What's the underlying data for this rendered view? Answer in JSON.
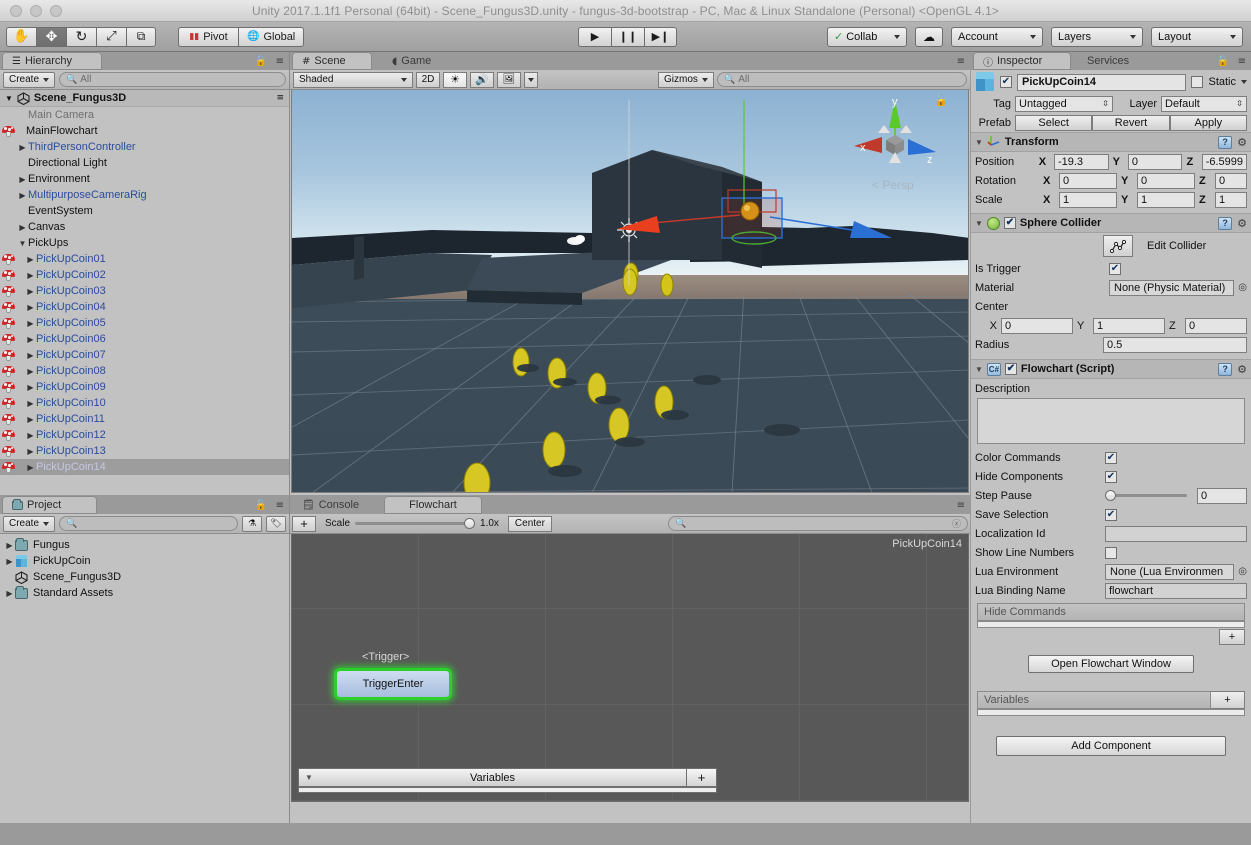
{
  "window": {
    "title": "Unity 2017.1.1f1 Personal (64bit) - Scene_Fungus3D.unity - fungus-3d-bootstrap - PC, Mac & Linux Standalone (Personal) <OpenGL 4.1>"
  },
  "toolbar": {
    "tools": [
      {
        "name": "hand-tool",
        "glyph": "✋",
        "active": false
      },
      {
        "name": "move-tool",
        "glyph": "✥",
        "active": true
      },
      {
        "name": "rotate-tool",
        "glyph": "⟳",
        "active": false
      },
      {
        "name": "scale-tool",
        "glyph": "⤢",
        "active": false
      },
      {
        "name": "rect-tool",
        "glyph": "❑",
        "active": false
      }
    ],
    "pivot_label": "Pivot",
    "global_label": "Global",
    "play_label": "▶",
    "pause_label": "❙❙",
    "step_label": "▶❙",
    "collab_label": "Collab",
    "cloud_label": "☁",
    "account_label": "Account",
    "layers_label": "Layers",
    "layout_label": "Layout"
  },
  "hierarchy": {
    "tab_label": "Hierarchy",
    "create_label": "Create",
    "search_placeholder": "All",
    "scene_name": "Scene_Fungus3D",
    "items": [
      {
        "label": "Main Camera",
        "indent": 1,
        "arrow": false,
        "icon": "none",
        "style": "dim"
      },
      {
        "label": "MainFlowchart",
        "indent": 1,
        "arrow": false,
        "icon": "mushroom",
        "style": "normal"
      },
      {
        "label": "ThirdPersonController",
        "indent": 1,
        "arrow": true,
        "icon": "none",
        "style": "prefab"
      },
      {
        "label": "Directional Light",
        "indent": 1,
        "arrow": false,
        "icon": "none",
        "style": "normal"
      },
      {
        "label": "Environment",
        "indent": 1,
        "arrow": true,
        "icon": "none",
        "style": "normal"
      },
      {
        "label": "MultipurposeCameraRig",
        "indent": 1,
        "arrow": true,
        "icon": "none",
        "style": "prefab"
      },
      {
        "label": "EventSystem",
        "indent": 1,
        "arrow": false,
        "icon": "none",
        "style": "normal"
      },
      {
        "label": "Canvas",
        "indent": 1,
        "arrow": true,
        "icon": "none",
        "style": "normal"
      },
      {
        "label": "PickUps",
        "indent": 1,
        "arrow": "open",
        "icon": "none",
        "style": "normal"
      },
      {
        "label": "PickUpCoin01",
        "indent": 2,
        "arrow": true,
        "icon": "mushroom",
        "style": "prefab"
      },
      {
        "label": "PickUpCoin02",
        "indent": 2,
        "arrow": true,
        "icon": "mushroom",
        "style": "prefab"
      },
      {
        "label": "PickUpCoin03",
        "indent": 2,
        "arrow": true,
        "icon": "mushroom",
        "style": "prefab"
      },
      {
        "label": "PickUpCoin04",
        "indent": 2,
        "arrow": true,
        "icon": "mushroom",
        "style": "prefab"
      },
      {
        "label": "PickUpCoin05",
        "indent": 2,
        "arrow": true,
        "icon": "mushroom",
        "style": "prefab"
      },
      {
        "label": "PickUpCoin06",
        "indent": 2,
        "arrow": true,
        "icon": "mushroom",
        "style": "prefab"
      },
      {
        "label": "PickUpCoin07",
        "indent": 2,
        "arrow": true,
        "icon": "mushroom",
        "style": "prefab"
      },
      {
        "label": "PickUpCoin08",
        "indent": 2,
        "arrow": true,
        "icon": "mushroom",
        "style": "prefab"
      },
      {
        "label": "PickUpCoin09",
        "indent": 2,
        "arrow": true,
        "icon": "mushroom",
        "style": "prefab"
      },
      {
        "label": "PickUpCoin10",
        "indent": 2,
        "arrow": true,
        "icon": "mushroom",
        "style": "prefab"
      },
      {
        "label": "PickUpCoin11",
        "indent": 2,
        "arrow": true,
        "icon": "mushroom",
        "style": "prefab"
      },
      {
        "label": "PickUpCoin12",
        "indent": 2,
        "arrow": true,
        "icon": "mushroom",
        "style": "prefab"
      },
      {
        "label": "PickUpCoin13",
        "indent": 2,
        "arrow": true,
        "icon": "mushroom",
        "style": "prefab"
      },
      {
        "label": "PickUpCoin14",
        "indent": 2,
        "arrow": true,
        "icon": "mushroom",
        "style": "selected",
        "selected": true
      }
    ]
  },
  "project": {
    "tab_label": "Project",
    "create_label": "Create",
    "search_placeholder": "",
    "items": [
      {
        "label": "Fungus",
        "arrow": true,
        "icon": "folder"
      },
      {
        "label": "PickUpCoin",
        "arrow": true,
        "icon": "cube"
      },
      {
        "label": "Scene_Fungus3D",
        "arrow": false,
        "icon": "unity"
      },
      {
        "label": "Standard Assets",
        "arrow": true,
        "icon": "folder"
      }
    ]
  },
  "scene_view": {
    "tabs": [
      {
        "label": "Scene",
        "active": true
      },
      {
        "label": "Game",
        "active": false
      }
    ],
    "shading_mode": "Shaded",
    "mode_2d": "2D",
    "gizmos_label": "Gizmos",
    "search_placeholder": "All",
    "gizmo": {
      "x_label": "x",
      "y_label": "y",
      "z_label": "z",
      "perspective_label": "< Persp",
      "x_color": "#c0392b",
      "y_color": "#5cc92b",
      "z_color": "#2a6fd4"
    },
    "colors": {
      "sky_top": "#8fb4d4",
      "sky_horizon": "#dceaf2",
      "ground_far": "#8d7d74",
      "floor": "#3e4f5c",
      "building": "#2e3a45"
    }
  },
  "flowchart_panel": {
    "tabs": [
      {
        "label": "Console",
        "active": false
      },
      {
        "label": "Flowchart",
        "active": true
      }
    ],
    "add_label": "+",
    "scale_label": "Scale",
    "scale_value": "1.0x",
    "center_label": "Center",
    "search_placeholder": "",
    "flowchart_name": "PickUpCoin14",
    "block_event_label": "<Trigger>",
    "block_label": "TriggerEnter",
    "variables_label": "Variables",
    "variables_add_label": "+"
  },
  "inspector": {
    "tabs": [
      {
        "label": "Inspector",
        "active": true
      },
      {
        "label": "Services",
        "active": false
      }
    ],
    "object_name": "PickUpCoin14",
    "object_enabled": true,
    "static_label": "Static",
    "static_checked": false,
    "tag_label": "Tag",
    "tag_value": "Untagged",
    "layer_label": "Layer",
    "layer_value": "Default",
    "prefab_label": "Prefab",
    "prefab_select": "Select",
    "prefab_revert": "Revert",
    "prefab_apply": "Apply",
    "transform": {
      "title": "Transform",
      "position_label": "Position",
      "position": {
        "x": "-19.3",
        "y": "0",
        "z": "-6.5999"
      },
      "rotation_label": "Rotation",
      "rotation": {
        "x": "0",
        "y": "0",
        "z": "0"
      },
      "scale_label": "Scale",
      "scale": {
        "x": "1",
        "y": "1",
        "z": "1"
      },
      "axis_x": "X",
      "axis_y": "Y",
      "axis_z": "Z"
    },
    "sphere_collider": {
      "title": "Sphere Collider",
      "enabled": true,
      "edit_collider_label": "Edit Collider",
      "is_trigger_label": "Is Trigger",
      "is_trigger": true,
      "material_label": "Material",
      "material_value": "None (Physic Material)",
      "center_label": "Center",
      "center": {
        "x": "0",
        "y": "1",
        "z": "0"
      },
      "radius_label": "Radius",
      "radius_value": "0.5"
    },
    "flowchart_script": {
      "title": "Flowchart (Script)",
      "enabled": true,
      "description_label": "Description",
      "description_value": "",
      "color_commands_label": "Color Commands",
      "color_commands": true,
      "hide_components_label": "Hide Components",
      "hide_components": true,
      "step_pause_label": "Step Pause",
      "step_pause_value": "0",
      "save_selection_label": "Save Selection",
      "save_selection": true,
      "localization_id_label": "Localization Id",
      "localization_id_value": "",
      "show_line_numbers_label": "Show Line Numbers",
      "show_line_numbers": false,
      "lua_environment_label": "Lua Environment",
      "lua_environment_value": "None (Lua Environmen",
      "lua_binding_name_label": "Lua Binding Name",
      "lua_binding_name_value": "flowchart",
      "hide_commands_label": "Hide Commands",
      "hide_commands_add": "+",
      "open_flowchart_window_label": "Open Flowchart Window",
      "variables_label": "Variables",
      "variables_add": "+"
    },
    "add_component_label": "Add Component"
  }
}
